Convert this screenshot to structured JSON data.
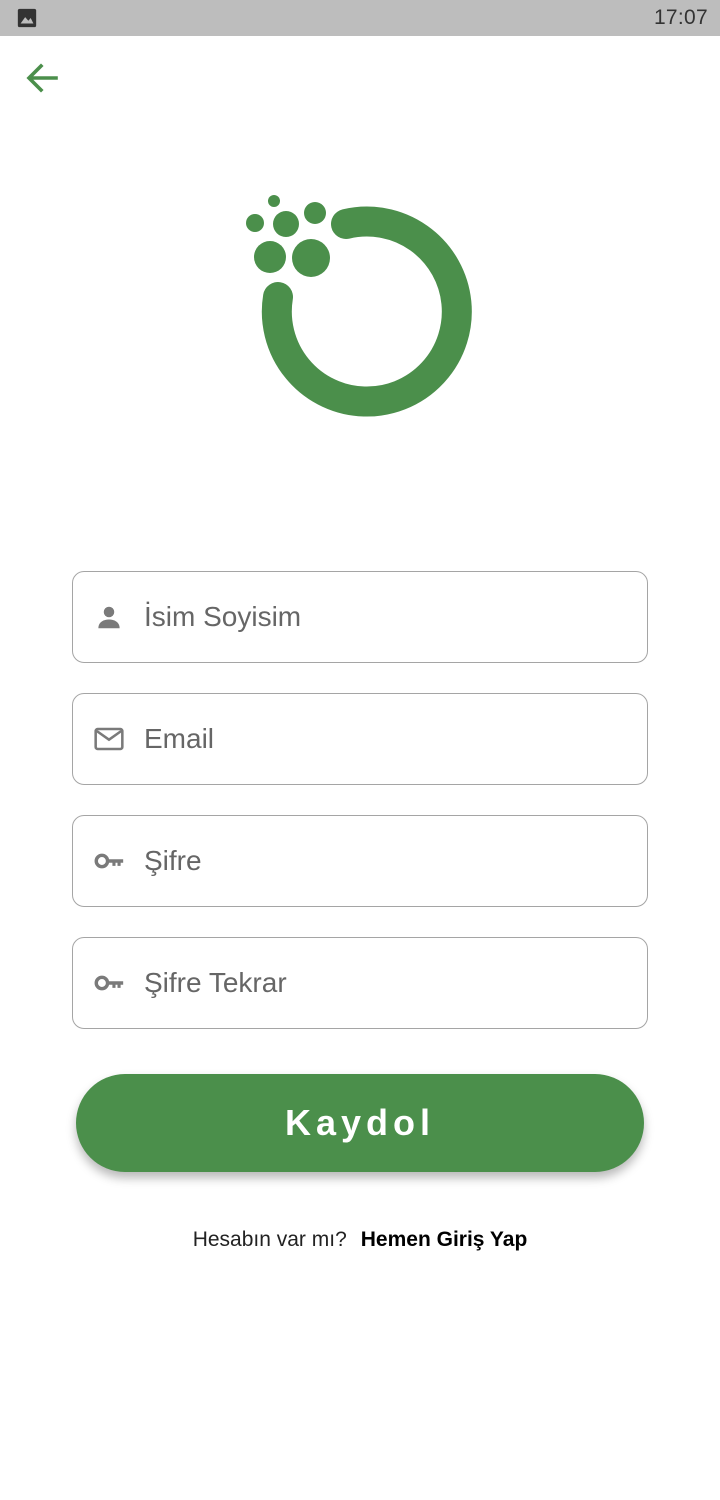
{
  "status_bar": {
    "time": "17:07",
    "notification_icon": "image-icon"
  },
  "header": {
    "back_icon": "arrow-left-icon"
  },
  "brand": {
    "logo_icon": "ring-with-dots-logo",
    "color": "#4b8f4b"
  },
  "form": {
    "name": {
      "placeholder": "İsim Soyisim",
      "value": "",
      "icon": "person-icon"
    },
    "email": {
      "placeholder": "Email",
      "value": "",
      "icon": "mail-icon"
    },
    "password": {
      "placeholder": "Şifre",
      "value": "",
      "icon": "key-icon"
    },
    "password_confirm": {
      "placeholder": "Şifre Tekrar",
      "value": "",
      "icon": "key-icon"
    },
    "submit_label": "Kaydol"
  },
  "footer": {
    "question": "Hesabın var mı?",
    "login_link": "Hemen Giriş Yap"
  },
  "colors": {
    "primary": "#4b8f4b",
    "status_bar": "#bdbdbd",
    "field_border": "#a5a5a5",
    "icon_gray": "#7a7a7a"
  }
}
